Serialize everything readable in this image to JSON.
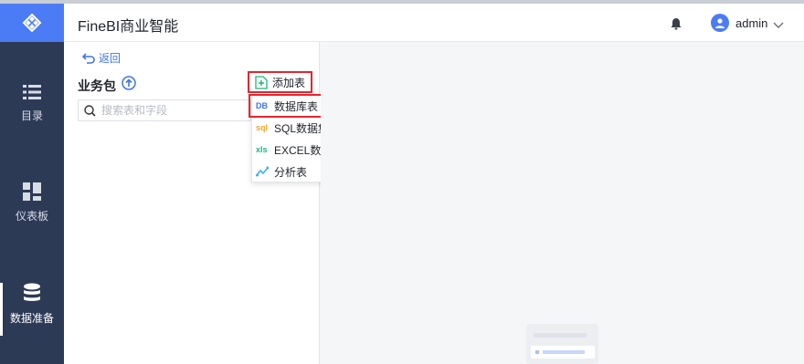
{
  "header": {
    "app_title": "FineBI商业智能",
    "user_name": "admin"
  },
  "sidebar": {
    "items": [
      {
        "label": "目录",
        "icon": "list-icon"
      },
      {
        "label": "仪表板",
        "icon": "dashboard-icon"
      },
      {
        "label": "数据准备",
        "icon": "database-icon",
        "active": true
      }
    ]
  },
  "panel": {
    "back_label": "返回",
    "title": "业务包",
    "search_placeholder": "搜索表和字段",
    "add_table_label": "添加表"
  },
  "dropdown": {
    "items": [
      {
        "label": "数据库表",
        "icon": "DB"
      },
      {
        "label": "SQL数据集",
        "icon": "sql"
      },
      {
        "label": "EXCEL数据集",
        "icon": "xls"
      },
      {
        "label": "分析表",
        "icon": "analysis-icon"
      }
    ]
  },
  "colors": {
    "sidebar_bg": "#2d3a56",
    "accent": "#4c7cf5",
    "highlight_border": "#e5262f"
  }
}
